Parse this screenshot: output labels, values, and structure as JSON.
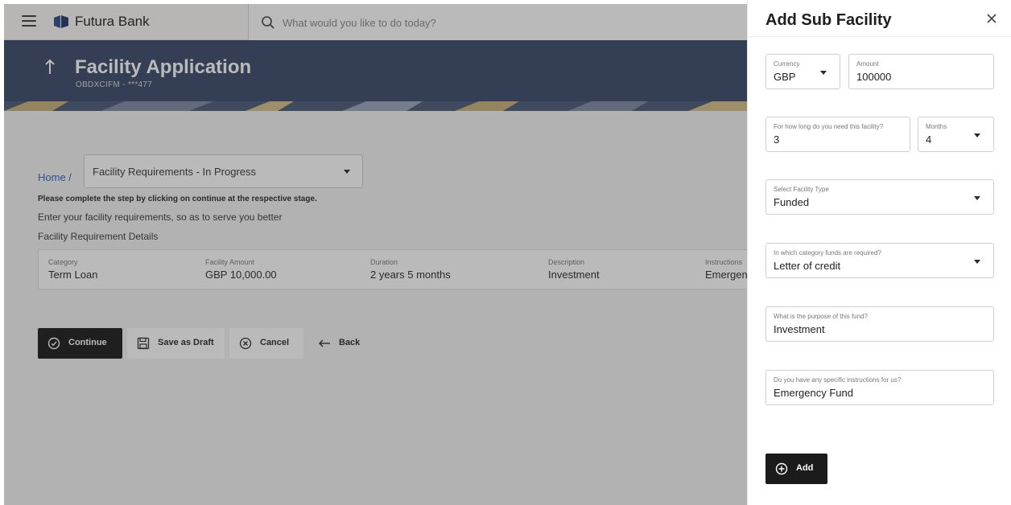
{
  "topbar": {
    "brand": "Futura Bank",
    "search_placeholder": "What would you like to do today?"
  },
  "banner": {
    "title": "Facility Application",
    "subtitle": "OBDXCIFM - ***477"
  },
  "breadcrumb": {
    "home": "Home /",
    "stage": "Facility Requirements - In Progress"
  },
  "notes": {
    "instruction": "Please complete the step by clicking on continue at the respective stage.",
    "helper": "Enter your facility requirements, so as to serve you better",
    "section_title": "Facility Requirement Details"
  },
  "details": [
    {
      "label": "Category",
      "value": "Term Loan"
    },
    {
      "label": "Facility Amount",
      "value": "GBP 10,000.00"
    },
    {
      "label": "Duration",
      "value": "2 years 5 months"
    },
    {
      "label": "Description",
      "value": "Investment"
    },
    {
      "label": "Instructions",
      "value": "Emergency Fund"
    }
  ],
  "actions": {
    "continue": "Continue",
    "save_draft": "Save as Draft",
    "cancel": "Cancel",
    "back": "Back"
  },
  "panel": {
    "title": "Add Sub Facility",
    "currency": {
      "label": "Currency",
      "value": "GBP"
    },
    "amount": {
      "label": "Amount",
      "value": "100000"
    },
    "duration": {
      "label": "For how long do you need this facility?",
      "value": "3"
    },
    "duration_unit": {
      "label": "Months",
      "value": "4"
    },
    "facility_type": {
      "label": "Select Facility Type",
      "value": "Funded"
    },
    "funds_category": {
      "label": "In which category funds are required?",
      "value": "Letter of credit"
    },
    "purpose": {
      "label": "What is the purpose of this fund?",
      "value": "Investment"
    },
    "instructions": {
      "label": "Do you have any specific instructions for us?",
      "value": "Emergency Fund"
    },
    "add_label": "Add"
  },
  "colors": {
    "banner": "#3a4a6a",
    "primary_button": "#1b1b1b",
    "link": "#2e66c2"
  }
}
